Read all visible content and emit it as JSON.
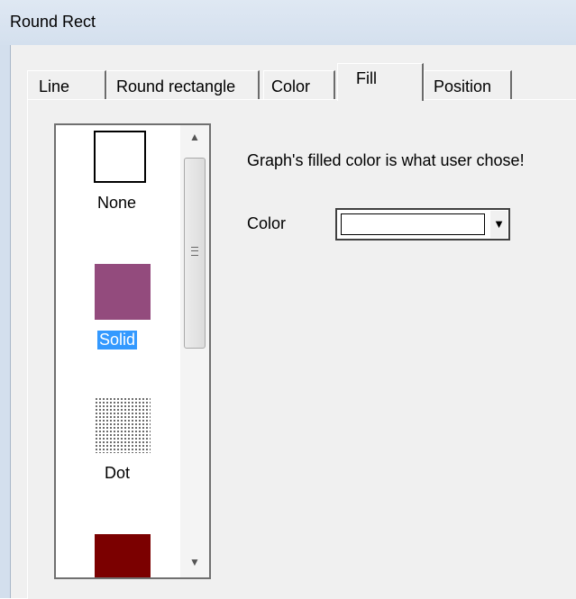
{
  "window": {
    "title": "Round Rect"
  },
  "tabs": [
    {
      "label": "Line",
      "selected": false
    },
    {
      "label": "Round rectangle",
      "selected": false
    },
    {
      "label": "Color",
      "selected": false
    },
    {
      "label": "Fill",
      "selected": true
    },
    {
      "label": "Position",
      "selected": false
    }
  ],
  "fill_list": {
    "items": [
      {
        "label": "None",
        "pattern": "none"
      },
      {
        "label": "Solid",
        "pattern": "solid",
        "color": "#934b7d",
        "selected": true
      },
      {
        "label": "Dot",
        "pattern": "dot"
      },
      {
        "label": "",
        "pattern": "solid",
        "color": "#7b0000"
      }
    ]
  },
  "scrollbar": {
    "up_icon": "triangle-up-icon",
    "down_icon": "triangle-down-icon"
  },
  "description": "Graph's filled color is what user chose!",
  "color_field": {
    "label": "Color",
    "value_color": "#ffffff"
  },
  "colors": {
    "selection": "#3399ff"
  }
}
